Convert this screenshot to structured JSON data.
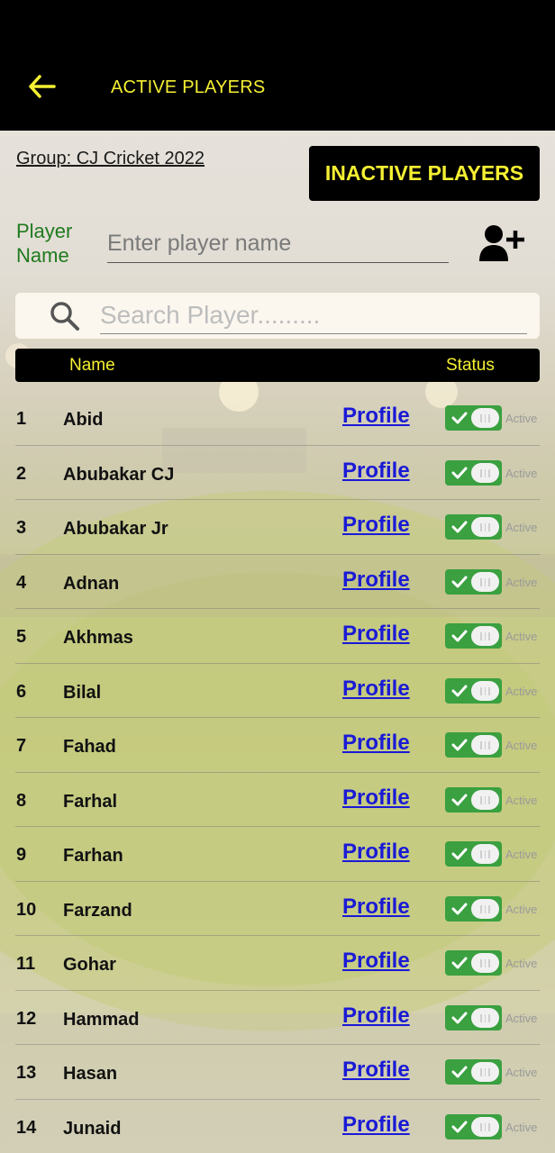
{
  "header": {
    "title": "ACTIVE PLAYERS",
    "back_icon": "arrow-left-icon"
  },
  "group": {
    "label": "Group: CJ Cricket 2022"
  },
  "inactive_button": {
    "label": "INACTIVE PLAYERS"
  },
  "add_player": {
    "label": "Player Name",
    "placeholder": "Enter player name",
    "value": "",
    "icon": "add-user-icon"
  },
  "search": {
    "placeholder": "Search Player.........",
    "value": "",
    "icon": "search-icon"
  },
  "table": {
    "columns": [
      "Name",
      "Status"
    ],
    "profile_label": "Profile",
    "status_label": "Active",
    "rows": [
      {
        "num": "1",
        "name": "Abid"
      },
      {
        "num": "2",
        "name": "Abubakar CJ"
      },
      {
        "num": "3",
        "name": "Abubakar Jr"
      },
      {
        "num": "4",
        "name": "Adnan"
      },
      {
        "num": "5",
        "name": "Akhmas"
      },
      {
        "num": "6",
        "name": "Bilal"
      },
      {
        "num": "7",
        "name": "Fahad"
      },
      {
        "num": "8",
        "name": "Farhal"
      },
      {
        "num": "9",
        "name": "Farhan"
      },
      {
        "num": "10",
        "name": "Farzand"
      },
      {
        "num": "11",
        "name": "Gohar"
      },
      {
        "num": "12",
        "name": "Hammad"
      },
      {
        "num": "13",
        "name": "Hasan"
      },
      {
        "num": "14",
        "name": "Junaid"
      }
    ]
  },
  "colors": {
    "accent_yellow": "#f5f032",
    "label_green": "#1f7a1f",
    "toggle_green": "#3aa040",
    "link_blue": "#1a1ad6"
  }
}
